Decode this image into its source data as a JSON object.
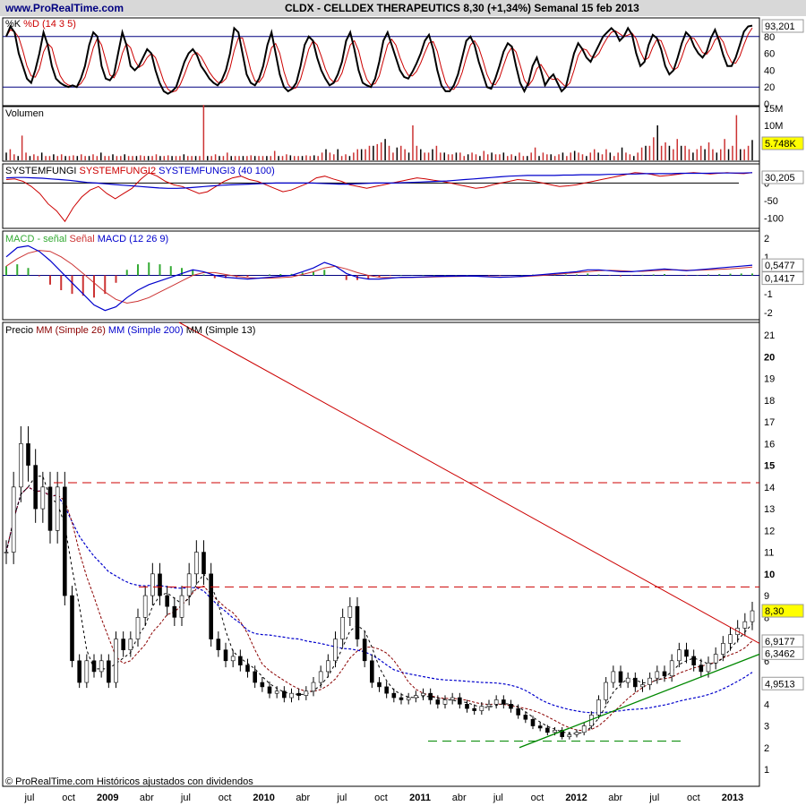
{
  "header": {
    "site": "www.ProRealTime.com",
    "title": "CLDX - CELLDEX THERAPEUTICS    8,30 (+1,34%)    Semanal  15 feb 2013"
  },
  "footer": {
    "note": "© ProRealTime.com  Históricos ajustados con dividendos"
  },
  "colors": {
    "grid": "#000080",
    "ma26": "#8b0000",
    "ma200": "#0000cc",
    "ma13": "#000000",
    "resistance": "#cc0000",
    "support": "#008800",
    "candle_up": "#ffffff",
    "candle_down": "#000000",
    "badge_last": "#ffff00",
    "badge_vol": "#ffff00"
  },
  "chart_data": [
    {
      "type": "line",
      "panel": "stochastic",
      "legend": [
        {
          "text": "%K",
          "color": "#000000"
        },
        {
          "text": "%D (14 3 5)",
          "color": "#cc0000"
        }
      ],
      "ylim": [
        0,
        100
      ],
      "ticks": [
        0,
        20,
        40,
        60,
        80
      ],
      "ref_levels": [
        20,
        80
      ],
      "last_value": "93,201",
      "series": [
        {
          "name": "%K",
          "values": [
            80,
            92,
            85,
            60,
            45,
            30,
            25,
            40,
            60,
            85,
            70,
            45,
            30,
            25,
            22,
            20,
            22,
            20,
            30,
            45,
            70,
            85,
            80,
            45,
            30,
            28,
            35,
            60,
            85,
            70,
            45,
            40,
            45,
            55,
            65,
            60,
            40,
            25,
            15,
            12,
            15,
            20,
            35,
            50,
            60,
            65,
            58,
            45,
            38,
            30,
            25,
            22,
            28,
            40,
            60,
            90,
            85,
            60,
            35,
            25,
            22,
            30,
            45,
            70,
            85,
            60,
            35,
            20,
            15,
            18,
            25,
            45,
            70,
            80,
            75,
            55,
            40,
            30,
            22,
            25,
            35,
            50,
            75,
            85,
            65,
            40,
            25,
            22,
            20,
            30,
            50,
            75,
            85,
            70,
            55,
            40,
            32,
            30,
            38,
            48,
            60,
            75,
            82,
            65,
            40,
            22,
            15,
            15,
            22,
            35,
            55,
            75,
            80,
            70,
            50,
            35,
            20,
            18,
            30,
            45,
            62,
            72,
            68,
            45,
            25,
            15,
            25,
            45,
            55,
            40,
            22,
            30,
            35,
            25,
            15,
            20,
            40,
            60,
            72,
            65,
            55,
            50,
            60,
            70,
            80,
            85,
            90,
            85,
            75,
            80,
            90,
            82,
            60,
            45,
            50,
            70,
            82,
            78,
            65,
            45,
            35,
            40,
            55,
            72,
            85,
            80,
            68,
            60,
            55,
            62,
            78,
            88,
            75,
            58,
            45,
            45,
            55,
            70,
            86,
            92,
            93
          ]
        }
      ]
    },
    {
      "type": "bar",
      "panel": "volume",
      "legend": [
        {
          "text": "Volumen",
          "color": "#000000"
        }
      ],
      "ylim": [
        0,
        15
      ],
      "ticks": [
        "15M",
        "10M",
        "5M"
      ],
      "last_value": "5.748K",
      "values": [
        2,
        3,
        1.5,
        1,
        7,
        2,
        1,
        1.5,
        1,
        2,
        1,
        1,
        1.5,
        1,
        1.5,
        1,
        1,
        1.2,
        1,
        1.5,
        1,
        1,
        1.5,
        1,
        2,
        1,
        1,
        1.5,
        1,
        1,
        1.5,
        1,
        1,
        1,
        1.2,
        1,
        1,
        1,
        1.5,
        1,
        1,
        1.2,
        1,
        1,
        1,
        1.5,
        1,
        1,
        1,
        1,
        16,
        1,
        1,
        1.5,
        1,
        1,
        2,
        1,
        1,
        1,
        1,
        1,
        1.2,
        1,
        1,
        1,
        1,
        1,
        2.5,
        1,
        1,
        1.5,
        1.2,
        1,
        1,
        1,
        1.2,
        1,
        1.2,
        1,
        2,
        3,
        2,
        1.5,
        3,
        1,
        1.5,
        1,
        2,
        3,
        3,
        3,
        4,
        4,
        4.5,
        5,
        6,
        4,
        2,
        3.5,
        4,
        3,
        2,
        10,
        4,
        3,
        2,
        2,
        3,
        4,
        2,
        2,
        1.5,
        1.5,
        2,
        2,
        1,
        1.5,
        2,
        1.5,
        1,
        2.5,
        1.5,
        2,
        1.5,
        1.5,
        2,
        1,
        1.5,
        1,
        2,
        1,
        1,
        2,
        3.5,
        1,
        2,
        1.5,
        1.5,
        1,
        1.5,
        2,
        1,
        2,
        2.5,
        2,
        1.5,
        1,
        2,
        3,
        2,
        1.5,
        3,
        2,
        1,
        2,
        3.5,
        2,
        1.5,
        1,
        2,
        3.5,
        4,
        4,
        6.5,
        10,
        4,
        5,
        4,
        3,
        6,
        4,
        4,
        3,
        2,
        3,
        4,
        3,
        5,
        3,
        2,
        3,
        6,
        3,
        4,
        13,
        3,
        3,
        4,
        5.7
      ]
    },
    {
      "type": "line",
      "panel": "systemfungi",
      "legend": [
        {
          "text": "SYSTEMFUNGI",
          "color": "#000000"
        },
        {
          "text": "SYSTEMFUNGI2",
          "color": "#cc0000"
        },
        {
          "text": "SYSTEMFUNGI3 (40 100)",
          "color": "#0000cc"
        }
      ],
      "ylim": [
        -125,
        50
      ],
      "ticks": [
        0,
        -50,
        -100
      ],
      "last_value": "30,205",
      "series": [
        {
          "name": "SYSTEMFUNGI2",
          "values": [
            10,
            12,
            5,
            -10,
            -30,
            -60,
            -80,
            -110,
            -70,
            -40,
            -20,
            -10,
            -30,
            -45,
            -30,
            -15,
            10,
            30,
            20,
            5,
            -5,
            -10,
            -20,
            -30,
            -25,
            -10,
            5,
            15,
            20,
            10,
            5,
            -5,
            -15,
            -25,
            -20,
            -10,
            0,
            15,
            20,
            12,
            5,
            -5,
            -10,
            -15,
            -10,
            -5,
            0,
            5,
            10,
            15,
            12,
            8,
            5,
            0,
            -5,
            -10,
            -15,
            -12,
            -5,
            0,
            5,
            10,
            8,
            5,
            0,
            -5,
            -10,
            -8,
            -5,
            0,
            5,
            10,
            15,
            20,
            25,
            30,
            28,
            25,
            20,
            22,
            25,
            28,
            30,
            28,
            26,
            28,
            30,
            28,
            27,
            30
          ]
        },
        {
          "name": "SYSTEMFUNGI3",
          "values": [
            15,
            16,
            16,
            15,
            14,
            12,
            10,
            8,
            5,
            2,
            0,
            -2,
            -4,
            -6,
            -8,
            -10,
            -12,
            -14,
            -15,
            -15,
            -14,
            -12,
            -10,
            -8,
            -6,
            -5,
            -4,
            -3,
            -2,
            -1,
            0,
            0,
            0,
            0,
            0,
            -1,
            -2,
            -3,
            -3,
            -2,
            -1,
            0,
            0,
            0,
            1,
            2,
            3,
            4,
            5,
            6,
            8,
            10,
            12,
            14,
            16,
            18,
            20,
            21,
            22,
            22,
            22,
            22,
            23,
            23,
            24,
            24,
            24,
            25,
            25,
            26,
            26,
            27,
            27,
            27,
            27,
            28,
            28,
            28,
            28,
            29,
            29,
            29,
            29,
            30
          ]
        }
      ]
    },
    {
      "type": "bar",
      "panel": "macd",
      "legend": [
        {
          "text": "MACD - señal",
          "color": "#33aa33"
        },
        {
          "text": "Señal",
          "color": "#cc3333"
        },
        {
          "text": "MACD (12 26 9)",
          "color": "#0000cc"
        }
      ],
      "ylim": [
        -2.3,
        2.3
      ],
      "ticks": [
        2,
        1,
        -1,
        -2
      ],
      "last_values": [
        "0,5477",
        "0,1417"
      ],
      "series": [
        {
          "name": "MACD",
          "values": [
            1,
            1.5,
            1.6,
            1.3,
            0.8,
            0.2,
            -0.4,
            -1,
            -1.6,
            -1.9,
            -1.7,
            -1.2,
            -0.8,
            -0.5,
            -0.3,
            -0.1,
            0.1,
            0.3,
            0.2,
            0,
            -0.1,
            -0.15,
            -0.2,
            -0.15,
            -0.1,
            -0.05,
            0,
            0.2,
            0.4,
            0.7,
            0.5,
            0.1,
            -0.1,
            -0.2,
            -0.2,
            -0.15,
            -0.1,
            -0.1,
            -0.08,
            -0.06,
            -0.05,
            -0.04,
            -0.03,
            -0.05,
            -0.08,
            -0.1,
            -0.08,
            -0.05,
            0,
            0.05,
            0.1,
            0.15,
            0.2,
            0.3,
            0.3,
            0.25,
            0.2,
            0.2,
            0.25,
            0.3,
            0.35,
            0.3,
            0.25,
            0.3,
            0.35,
            0.4,
            0.45,
            0.5,
            0.55
          ]
        },
        {
          "name": "Señal",
          "values": [
            0.5,
            0.9,
            1.2,
            1.35,
            1.3,
            1.0,
            0.6,
            0.1,
            -0.4,
            -0.9,
            -1.3,
            -1.5,
            -1.4,
            -1.2,
            -0.9,
            -0.6,
            -0.3,
            0,
            0.15,
            0.15,
            0.05,
            -0.05,
            -0.12,
            -0.15,
            -0.15,
            -0.12,
            -0.08,
            0.05,
            0.2,
            0.4,
            0.5,
            0.35,
            0.15,
            0,
            -0.1,
            -0.12,
            -0.12,
            -0.11,
            -0.1,
            -0.08,
            -0.07,
            -0.06,
            -0.05,
            -0.05,
            -0.06,
            -0.08,
            -0.08,
            -0.07,
            -0.04,
            0,
            0.05,
            0.1,
            0.15,
            0.2,
            0.25,
            0.27,
            0.25,
            0.22,
            0.22,
            0.25,
            0.28,
            0.3,
            0.28,
            0.28,
            0.3,
            0.33,
            0.36,
            0.4,
            0.45
          ]
        }
      ]
    },
    {
      "type": "line",
      "panel": "price",
      "legend": [
        {
          "text": "Precio",
          "color": "#000000"
        },
        {
          "text": "MM (Simple 26)",
          "color": "#8b0000"
        },
        {
          "text": "MM (Simple 200)",
          "color": "#0000cc"
        },
        {
          "text": "MM (Simple 13)",
          "color": "#000000"
        }
      ],
      "y_ticks": [
        21,
        20,
        19,
        18,
        17,
        16,
        15,
        14,
        13,
        12,
        11,
        10,
        9,
        8,
        7,
        6,
        5,
        4,
        3,
        2,
        1
      ],
      "ylim": [
        0.3,
        21.5
      ],
      "x_ticks": [
        "jul",
        "oct",
        "2009",
        "abr",
        "jul",
        "oct",
        "2010",
        "abr",
        "jul",
        "oct",
        "2011",
        "abr",
        "jul",
        "oct",
        "2012",
        "abr",
        "jul",
        "oct",
        "2013"
      ],
      "bold_years": [
        "2009",
        "2010",
        "2011",
        "2012",
        "2013"
      ],
      "last_price": "8,30",
      "price_labels": [
        {
          "text": "6,9177",
          "color": "#ffffff",
          "bg": "#ffffff"
        },
        {
          "text": "6,3462",
          "color": "#ffffff",
          "bg": "#ffffff"
        },
        {
          "text": "4,9513",
          "color": "#ffffff",
          "bg": "#ffffff"
        }
      ],
      "levels": {
        "resistance_1": 14.2,
        "resistance_2": 9.4,
        "support": 2.3
      },
      "series": [
        {
          "name": "close",
          "values": [
            11,
            14,
            16,
            15,
            13,
            14,
            12,
            14,
            9,
            6,
            5,
            6,
            5.5,
            6,
            5,
            7,
            6.5,
            7,
            8,
            9,
            10,
            9,
            8.5,
            8,
            9,
            10,
            11,
            10,
            7,
            6.5,
            6,
            6.2,
            5.8,
            5.5,
            5,
            4.8,
            4.5,
            4.6,
            4.3,
            4.5,
            4.4,
            4.6,
            5,
            5.5,
            6,
            7,
            8,
            8.5,
            7,
            6,
            5,
            4.8,
            4.5,
            4.3,
            4.2,
            4.3,
            4.4,
            4.5,
            4.2,
            4.0,
            4.2,
            4.3,
            4.0,
            3.8,
            3.7,
            3.9,
            4.0,
            4.2,
            4.0,
            3.8,
            3.5,
            3.3,
            3.0,
            2.9,
            2.7,
            2.8,
            2.5,
            2.6,
            2.7,
            3.0,
            3.5,
            4.2,
            5,
            5.5,
            5.0,
            5.2,
            4.8,
            4.9,
            5.2,
            5.5,
            5.3,
            6.0,
            6.5,
            6.2,
            5.8,
            5.5,
            5.9,
            6.3,
            6.8,
            7.2,
            7.5,
            7.8,
            8.3
          ]
        }
      ]
    }
  ]
}
